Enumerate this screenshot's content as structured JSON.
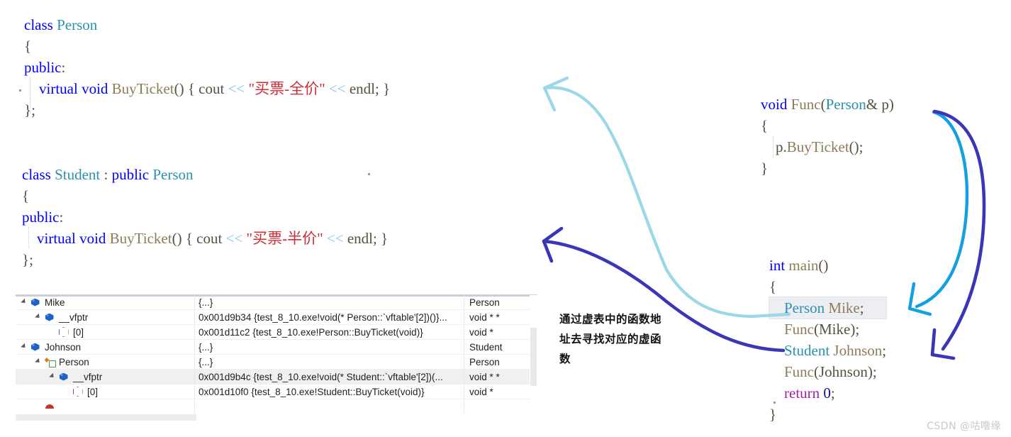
{
  "meta": {
    "watermark": "CSDN @咕噜缘"
  },
  "code_person": {
    "lines": [
      [
        {
          "t": "class",
          "c": "kw"
        },
        {
          "t": " ",
          "c": "plain"
        },
        {
          "t": "Person",
          "c": "type"
        }
      ],
      [
        {
          "t": "{",
          "c": "plain"
        }
      ],
      [
        {
          "t": "public",
          "c": "kw"
        },
        {
          "t": ":",
          "c": "plain"
        }
      ],
      [
        {
          "t": "    ",
          "c": "plain"
        },
        {
          "t": "virtual",
          "c": "kw"
        },
        {
          "t": " ",
          "c": "plain"
        },
        {
          "t": "void",
          "c": "kw"
        },
        {
          "t": " ",
          "c": "plain"
        },
        {
          "t": "BuyTicket",
          "c": "fn"
        },
        {
          "t": "() { ",
          "c": "plain"
        },
        {
          "t": "cout",
          "c": "plain"
        },
        {
          "t": " ",
          "c": "plain"
        },
        {
          "t": "<<",
          "c": "op"
        },
        {
          "t": " ",
          "c": "plain"
        },
        {
          "t": "\"买票-全价\"",
          "c": "str"
        },
        {
          "t": " ",
          "c": "plain"
        },
        {
          "t": "<<",
          "c": "op"
        },
        {
          "t": " ",
          "c": "plain"
        },
        {
          "t": "endl",
          "c": "plain"
        },
        {
          "t": "; }",
          "c": "plain"
        }
      ],
      [
        {
          "t": "};",
          "c": "plain"
        }
      ]
    ]
  },
  "code_student": {
    "lines": [
      [
        {
          "t": "class",
          "c": "kw"
        },
        {
          "t": " ",
          "c": "plain"
        },
        {
          "t": "Student",
          "c": "type"
        },
        {
          "t": " : ",
          "c": "plain"
        },
        {
          "t": "public",
          "c": "kw"
        },
        {
          "t": " ",
          "c": "plain"
        },
        {
          "t": "Person",
          "c": "type"
        }
      ],
      [
        {
          "t": "{",
          "c": "plain"
        }
      ],
      [
        {
          "t": "public",
          "c": "kw"
        },
        {
          "t": ":",
          "c": "plain"
        }
      ],
      [
        {
          "t": "    ",
          "c": "plain"
        },
        {
          "t": "virtual",
          "c": "kw"
        },
        {
          "t": " ",
          "c": "plain"
        },
        {
          "t": "void",
          "c": "kw"
        },
        {
          "t": " ",
          "c": "plain"
        },
        {
          "t": "BuyTicket",
          "c": "fn"
        },
        {
          "t": "() { ",
          "c": "plain"
        },
        {
          "t": "cout",
          "c": "plain"
        },
        {
          "t": " ",
          "c": "plain"
        },
        {
          "t": "<<",
          "c": "op"
        },
        {
          "t": " ",
          "c": "plain"
        },
        {
          "t": "\"买票-半价\"",
          "c": "str"
        },
        {
          "t": " ",
          "c": "plain"
        },
        {
          "t": "<<",
          "c": "op"
        },
        {
          "t": " ",
          "c": "plain"
        },
        {
          "t": "endl",
          "c": "plain"
        },
        {
          "t": "; }",
          "c": "plain"
        }
      ],
      [
        {
          "t": "};",
          "c": "plain"
        }
      ]
    ]
  },
  "code_func": {
    "lines": [
      [
        {
          "t": "void",
          "c": "kw"
        },
        {
          "t": " ",
          "c": "plain"
        },
        {
          "t": "Func",
          "c": "fn"
        },
        {
          "t": "(",
          "c": "plain"
        },
        {
          "t": "Person",
          "c": "type"
        },
        {
          "t": "& p)",
          "c": "plain"
        }
      ],
      [
        {
          "t": "{",
          "c": "plain"
        }
      ],
      [
        {
          "t": "    ",
          "c": "plain"
        },
        {
          "t": "p.",
          "c": "plain"
        },
        {
          "t": "BuyTicket",
          "c": "fn"
        },
        {
          "t": "();",
          "c": "plain"
        }
      ],
      [
        {
          "t": "}",
          "c": "plain"
        }
      ]
    ]
  },
  "code_main": {
    "lines": [
      {
        "highlight": false,
        "spans": [
          {
            "t": "int",
            "c": "kw"
          },
          {
            "t": " ",
            "c": "plain"
          },
          {
            "t": "main",
            "c": "fn"
          },
          {
            "t": "()",
            "c": "plain"
          }
        ]
      },
      {
        "highlight": false,
        "spans": [
          {
            "t": "{",
            "c": "plain"
          }
        ]
      },
      {
        "highlight": true,
        "spans": [
          {
            "t": "    ",
            "c": "plain"
          },
          {
            "t": "Person",
            "c": "type"
          },
          {
            "t": " ",
            "c": "plain"
          },
          {
            "t": "Mike",
            "c": "fn"
          },
          {
            "t": ";",
            "c": "plain"
          }
        ]
      },
      {
        "highlight": false,
        "spans": [
          {
            "t": "    ",
            "c": "plain"
          },
          {
            "t": "Func",
            "c": "fn"
          },
          {
            "t": "(",
            "c": "plain"
          },
          {
            "t": "Mike",
            "c": "plain"
          },
          {
            "t": ");",
            "c": "plain"
          }
        ]
      },
      {
        "highlight": false,
        "spans": [
          {
            "t": "    ",
            "c": "plain"
          },
          {
            "t": "Student",
            "c": "type"
          },
          {
            "t": " ",
            "c": "plain"
          },
          {
            "t": "Johnson",
            "c": "fn"
          },
          {
            "t": ";",
            "c": "plain"
          }
        ]
      },
      {
        "highlight": false,
        "spans": [
          {
            "t": "    ",
            "c": "plain"
          },
          {
            "t": "Func",
            "c": "fn"
          },
          {
            "t": "(",
            "c": "plain"
          },
          {
            "t": "Johnson",
            "c": "plain"
          },
          {
            "t": ");",
            "c": "plain"
          }
        ]
      },
      {
        "highlight": false,
        "spans": [
          {
            "t": "    ",
            "c": "plain"
          },
          {
            "t": "return",
            "c": "purple"
          },
          {
            "t": " ",
            "c": "plain"
          },
          {
            "t": "0",
            "c": "num"
          },
          {
            "t": ";",
            "c": "plain"
          }
        ]
      },
      {
        "highlight": false,
        "spans": [
          {
            "t": "}",
            "c": "plain"
          }
        ]
      }
    ]
  },
  "watch": {
    "rows": [
      {
        "indent": 0,
        "expander": true,
        "icon": "cube-icon",
        "pin": false,
        "selected": false,
        "name": "Mike",
        "value": "{...}",
        "type": "Person"
      },
      {
        "indent": 1,
        "expander": true,
        "icon": "cube-icon",
        "pin": false,
        "selected": false,
        "name": "__vfptr",
        "value": "0x001d9b34 {test_8_10.exe!void(* Person::`vftable'[2])()}...",
        "type": "void * *"
      },
      {
        "indent": 2,
        "expander": false,
        "icon": "hex-outline-icon",
        "pin": false,
        "selected": false,
        "name": "[0]",
        "value": "0x001d11c2 {test_8_10.exe!Person::BuyTicket(void)}",
        "type": "void *"
      },
      {
        "indent": 0,
        "expander": true,
        "icon": "cube-icon",
        "pin": false,
        "selected": false,
        "name": "Johnson",
        "value": "{...}",
        "type": "Student"
      },
      {
        "indent": 1,
        "expander": true,
        "icon": "base-class-icon",
        "pin": false,
        "selected": false,
        "name": "Person",
        "value": "{...}",
        "type": "Person"
      },
      {
        "indent": 2,
        "expander": true,
        "icon": "cube-icon",
        "pin": true,
        "selected": true,
        "name": "__vfptr",
        "value": "0x001d9b4c {test_8_10.exe!void(* Student::`vftable'[2])(...",
        "type": "void * *"
      },
      {
        "indent": 3,
        "expander": false,
        "icon": "hex-outline-icon",
        "pin": false,
        "selected": false,
        "name": "[0]",
        "value": "0x001d10f0 {test_8_10.exe!Student::BuyTicket(void)}",
        "type": "void *"
      },
      {
        "indent": 1,
        "expander": false,
        "icon": "red-cap-icon",
        "pin": false,
        "selected": false,
        "name": "",
        "value": "",
        "type": ""
      }
    ]
  },
  "note": {
    "line1": "通过虚表中的函数地",
    "line2": "址去寻找对应的虚函",
    "line3": "数"
  },
  "colors": {
    "keyword": "#0000ff",
    "type_name": "#2b91af",
    "function": "#8b7d55",
    "string": "#cf2c36",
    "operator": "#83c6e4",
    "arrow_light_blue": "#9ad8e8",
    "arrow_cyan": "#12a0e0",
    "arrow_dark_blue": "#3b35b8",
    "selection_highlight": "#eceef4"
  },
  "arrows": [
    {
      "name": "arrow-person-to-mike",
      "color": "#9ad8e8"
    },
    {
      "name": "arrow-student-to-johnson",
      "color": "#3b35b8"
    },
    {
      "name": "arrow-func-to-mike",
      "color": "#12a0e0"
    },
    {
      "name": "arrow-func-to-johnson",
      "color": "#3b35b8"
    }
  ]
}
